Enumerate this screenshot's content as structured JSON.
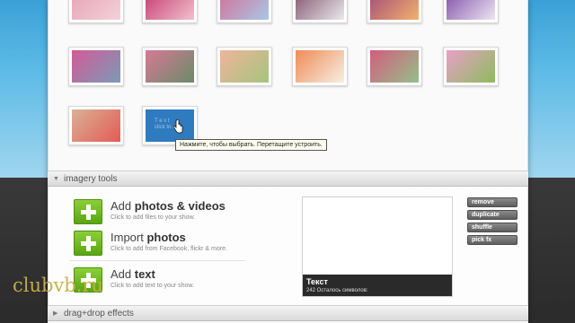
{
  "thumbnails": [
    {
      "row": 1,
      "colors": [
        "#e7a2b4",
        "#f4d1da"
      ]
    },
    {
      "row": 1,
      "colors": [
        "#c4366b",
        "#f1c2cf"
      ]
    },
    {
      "row": 1,
      "colors": [
        "#d56c94",
        "#a8c8e6"
      ]
    },
    {
      "row": 1,
      "colors": [
        "#7f4e6b",
        "#eaeaea"
      ]
    },
    {
      "row": 1,
      "colors": [
        "#a14677",
        "#f1b26f"
      ]
    },
    {
      "row": 1,
      "colors": [
        "#7b4aa6",
        "#eee6f2"
      ]
    },
    {
      "row": 2,
      "colors": [
        "#d45b95",
        "#7a9ab8"
      ]
    },
    {
      "row": 2,
      "colors": [
        "#d77a94",
        "#6a8b6a"
      ]
    },
    {
      "row": 2,
      "colors": [
        "#efb49a",
        "#a5c57e"
      ]
    },
    {
      "row": 2,
      "colors": [
        "#f08b54",
        "#f7efe4"
      ]
    },
    {
      "row": 2,
      "colors": [
        "#d45d7d",
        "#93c08b"
      ]
    },
    {
      "row": 2,
      "colors": [
        "#e9a0c8",
        "#8cbc5c"
      ]
    },
    {
      "row": 3,
      "colors": [
        "#d9b197",
        "#e35b55"
      ]
    }
  ],
  "selected_thumb": {
    "line1": "T e x t",
    "line2": "click to edit"
  },
  "tooltip": "Нажмите, чтобы выбрать. Перетащите устроить.",
  "imagery_bar": {
    "label": "imagery tools"
  },
  "tools": [
    {
      "prefix": "Add ",
      "bold": "photos & videos",
      "sub": "Click to add files to your show."
    },
    {
      "prefix": "Import ",
      "bold": "photos",
      "sub": "Click to add from Facebook, flickr & more."
    },
    {
      "prefix": "Add ",
      "bold": "text",
      "sub": "Click to add text to your show."
    }
  ],
  "preview": {
    "title": "Текст",
    "counter": "242 Осталось символов:"
  },
  "buttons": [
    "remove",
    "duplicate",
    "shuffle",
    "pick fx"
  ],
  "dragdrop_bar": {
    "label": "drag+drop effects"
  },
  "watermark": "clubvb.ru",
  "colors": {
    "accent_blue": "#2f7bc0",
    "plus_green": "#6bb51e",
    "sky": "#4fb3e2"
  }
}
